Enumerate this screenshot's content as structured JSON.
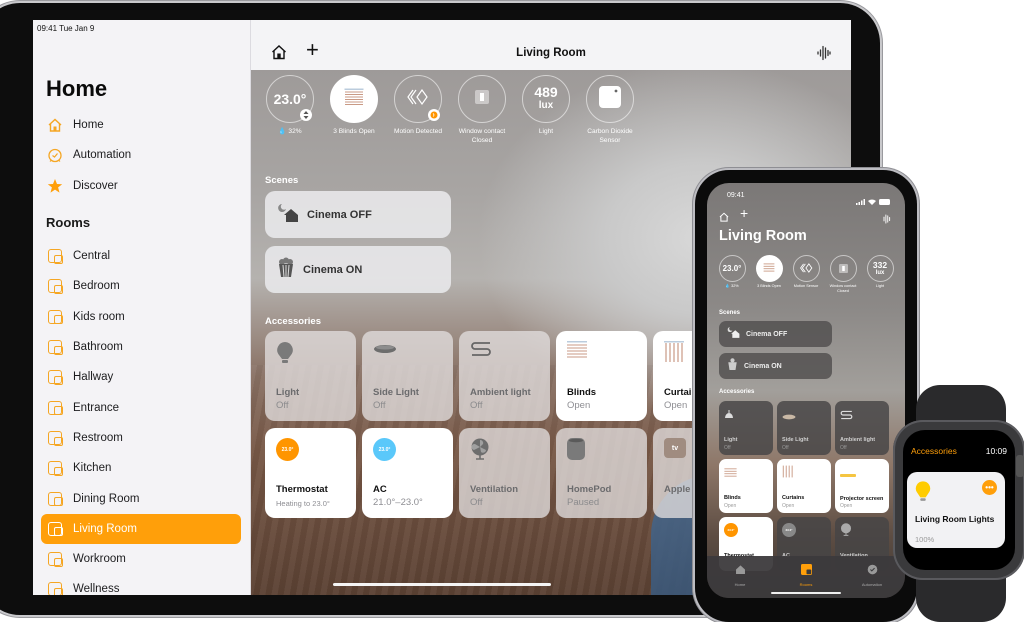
{
  "ipad": {
    "status_bar": {
      "time_date": "09:41  Tue Jan 9"
    },
    "sidebar": {
      "title": "Home",
      "nav": [
        {
          "label": "Home",
          "icon": "house-icon"
        },
        {
          "label": "Automation",
          "icon": "clock-icon"
        },
        {
          "label": "Discover",
          "icon": "star-icon"
        }
      ],
      "rooms_header": "Rooms",
      "rooms": [
        {
          "label": "Central"
        },
        {
          "label": "Bedroom"
        },
        {
          "label": "Kids room"
        },
        {
          "label": "Bathroom"
        },
        {
          "label": "Hallway"
        },
        {
          "label": "Entrance"
        },
        {
          "label": "Restroom"
        },
        {
          "label": "Kitchen"
        },
        {
          "label": "Dining Room"
        },
        {
          "label": "Living Room",
          "selected": true
        },
        {
          "label": "Workroom"
        },
        {
          "label": "Wellness"
        }
      ]
    },
    "header": {
      "title": "Living Room"
    },
    "status": [
      {
        "value": "23.0°",
        "label": "💧 32%"
      },
      {
        "value": "",
        "label": "3 Blinds Open"
      },
      {
        "value": "",
        "label": "Motion Detected"
      },
      {
        "value": "",
        "label": "Window contact\nClosed"
      },
      {
        "value": "489",
        "unit": "lux",
        "label": "Light"
      },
      {
        "value": "",
        "label": "Carbon Dioxide\nSensor"
      }
    ],
    "scenes_header": "Scenes",
    "scenes": [
      {
        "label": "Cinema OFF"
      },
      {
        "label": "Cinema ON"
      }
    ],
    "accessories_header": "Accessories",
    "accessories": [
      {
        "name": "Light",
        "state": "Off",
        "on": false
      },
      {
        "name": "Side Light",
        "state": "Off",
        "on": false
      },
      {
        "name": "Ambient light",
        "state": "Off",
        "on": false
      },
      {
        "name": "Blinds",
        "state": "Open",
        "on": true
      },
      {
        "name": "Curtains",
        "state": "Open",
        "on": true
      },
      {
        "name": "Thermostat",
        "state": "Heating to 23.0°",
        "on": true,
        "badge": "23.0°"
      },
      {
        "name": "AC",
        "state": "21.0°–23.0°",
        "on": true,
        "badge": "23.0°"
      },
      {
        "name": "Ventilation",
        "state": "Off",
        "on": false
      },
      {
        "name": "HomePod",
        "state": "Paused",
        "on": false
      },
      {
        "name": "Apple TV",
        "state": "",
        "on": false,
        "badge": "tv"
      }
    ]
  },
  "iphone": {
    "status_bar": {
      "time": "09:41"
    },
    "title": "Living Room",
    "status": [
      {
        "value": "23.0°",
        "label": "💧 32%"
      },
      {
        "value": "",
        "label": "3 Blinds Open"
      },
      {
        "value": "",
        "label": "Motion Sensor"
      },
      {
        "value": "",
        "label": "Window contact\nClosed"
      },
      {
        "value": "332",
        "unit": "lux",
        "label": "Light"
      }
    ],
    "scenes_header": "Scenes",
    "scenes": [
      {
        "label": "Cinema OFF"
      },
      {
        "label": "Cinema ON"
      }
    ],
    "accessories_header": "Accessories",
    "accessories": [
      {
        "name": "Light",
        "state": "Off",
        "on": false
      },
      {
        "name": "Side Light",
        "state": "Off",
        "on": false
      },
      {
        "name": "Ambient light",
        "state": "Off",
        "on": false
      },
      {
        "name": "Blinds",
        "state": "Open",
        "on": true
      },
      {
        "name": "Curtains",
        "state": "Open",
        "on": true
      },
      {
        "name": "Projector screen",
        "state": "Open",
        "on": true
      },
      {
        "name": "Thermostat",
        "state": "",
        "on": true,
        "badge": "23.0°"
      },
      {
        "name": "AC",
        "state": "",
        "on": false,
        "badge": "23.0°"
      },
      {
        "name": "Ventilation",
        "state": "",
        "on": false
      }
    ],
    "tabs": [
      {
        "label": "Home",
        "active": false
      },
      {
        "label": "Rooms",
        "active": true
      },
      {
        "label": "Automation",
        "active": false
      }
    ]
  },
  "watch": {
    "title": "Accessories",
    "time": "10:09",
    "card": {
      "name": "Living Room Lights",
      "value": "100%"
    }
  },
  "colors": {
    "accent": "#ff9f0a",
    "room_icon": "#f5a623",
    "thermostat": "#ff9500",
    "ac": "#5ac8fa",
    "bulb": "#ffcc00"
  }
}
